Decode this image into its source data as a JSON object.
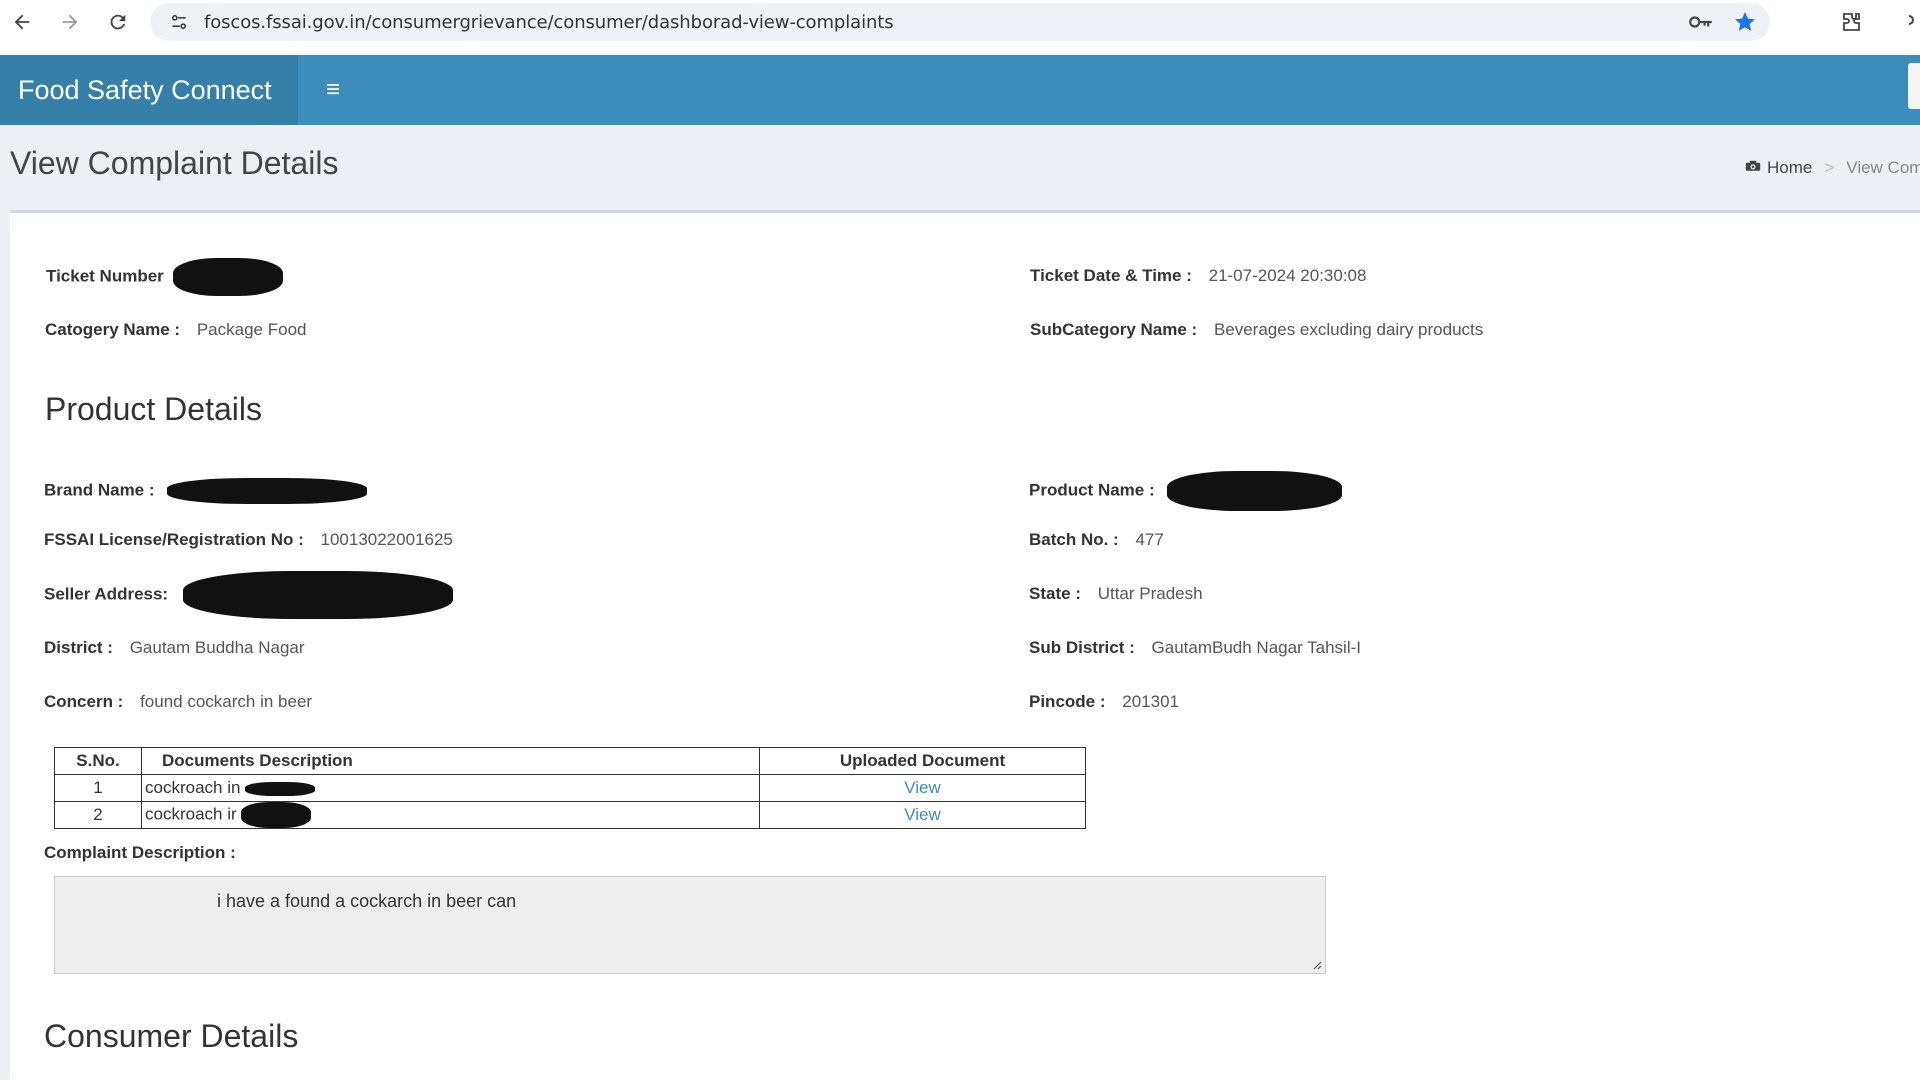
{
  "browser": {
    "url": "foscos.fssai.gov.in/consumergrievance/consumer/dashborad-view-complaints",
    "icons": [
      "back-icon",
      "forward-icon",
      "reload-icon",
      "site-info-icon",
      "key-icon",
      "star-icon",
      "extensions-icon"
    ]
  },
  "header": {
    "app_title": "Food Safety Connect",
    "menu_glyph": "≡"
  },
  "page": {
    "title": "View Complaint Details",
    "breadcrumb": {
      "home": "Home",
      "current": "View Comp"
    }
  },
  "complaint": {
    "ticket_number_label": "Ticket Number",
    "ticket_datetime_label": "Ticket Date & Time :",
    "ticket_datetime": "21-07-2024 20:30:08",
    "category_label": "Catogery Name :",
    "category": "Package Food",
    "subcategory_label": "SubCategory Name :",
    "subcategory": "Beverages excluding dairy products"
  },
  "product": {
    "section_title": "Product Details",
    "brand_label": "Brand Name :",
    "product_name_label": "Product Name :",
    "license_label": "FSSAI License/Registration No :",
    "license": "10013022001625",
    "batch_label": "Batch No. :",
    "batch": "477",
    "seller_label": "Seller Address:",
    "state_label": "State :",
    "state": "Uttar Pradesh",
    "district_label": "District :",
    "district": "Gautam Buddha Nagar",
    "subdistrict_label": "Sub District :",
    "subdistrict": "GautamBudh Nagar Tahsil-I",
    "concern_label": "Concern :",
    "concern": "found cockarch in beer",
    "pincode_label": "Pincode :",
    "pincode": "201301"
  },
  "documents": {
    "headers": [
      "S.No.",
      "Documents Description",
      "Uploaded Document"
    ],
    "rows": [
      {
        "sno": "1",
        "desc": "cockroach in",
        "link": "View"
      },
      {
        "sno": "2",
        "desc": "cockroach ir",
        "link": "View"
      }
    ]
  },
  "complaint_description": {
    "label": "Complaint Description :",
    "text": "i have a found a cockarch in beer can"
  },
  "consumer": {
    "section_title": "Consumer Details"
  }
}
